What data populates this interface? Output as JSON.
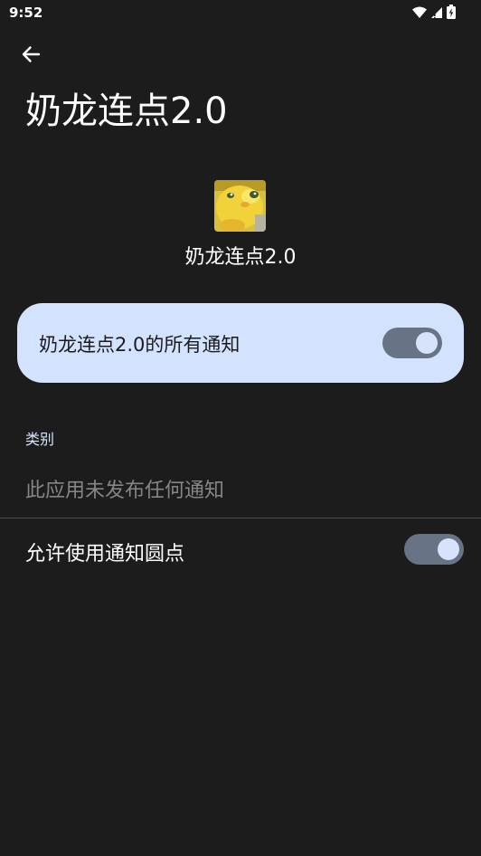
{
  "status_bar": {
    "time": "9:52",
    "icons": [
      "wifi-icon",
      "signal-icon",
      "battery-icon"
    ]
  },
  "header": {
    "back_icon": "arrow-back-icon",
    "title": "奶龙连点2.0"
  },
  "app": {
    "name": "奶龙连点2.0",
    "icon": "app-icon"
  },
  "all_notifications": {
    "label": "奶龙连点2.0的所有通知",
    "enabled": true
  },
  "categories": {
    "header": "类别",
    "empty_message": "此应用未发布任何通知"
  },
  "notification_dots": {
    "label": "允许使用通知圆点",
    "enabled": true
  },
  "colors": {
    "background": "#1c1c1c",
    "card_background": "#d3e3fd",
    "toggle_track": "#687385",
    "toggle_thumb": "#d7e3fb",
    "section_header": "#d4e3ff"
  }
}
